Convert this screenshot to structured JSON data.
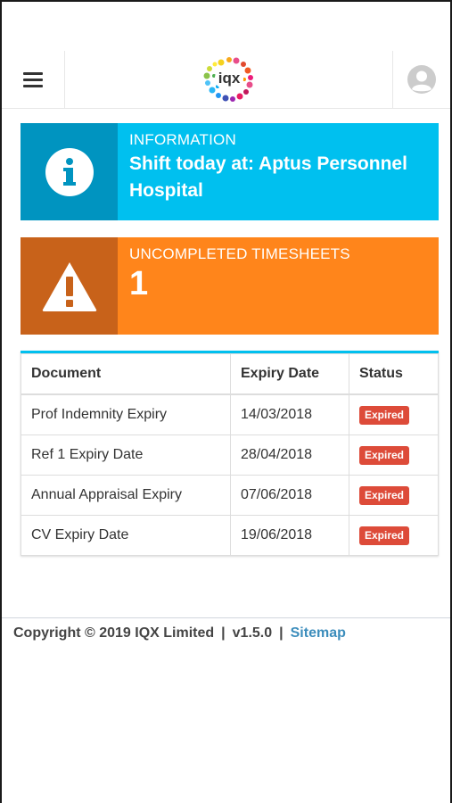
{
  "header": {
    "menu_icon": "hamburger-menu-icon",
    "logo_text": "iqx",
    "avatar_icon": "user-avatar-icon"
  },
  "info_box": {
    "label": "INFORMATION",
    "text": "Shift today at: Aptus Personnel Hospital",
    "icon": "info-icon",
    "color": "#00c0ef",
    "icon_bg": "#0094c0"
  },
  "warning_box": {
    "label": "UNCOMPLETED TIMESHEETS",
    "count": "1",
    "icon": "warning-icon",
    "color": "#ff851b",
    "icon_bg": "#c8621a"
  },
  "documents": {
    "columns": [
      "Document",
      "Expiry Date",
      "Status"
    ],
    "rows": [
      {
        "document": "Prof Indemnity Expiry",
        "expiry": "14/03/2018",
        "status": "Expired"
      },
      {
        "document": "Ref 1 Expiry Date",
        "expiry": "28/04/2018",
        "status": "Expired"
      },
      {
        "document": "Annual Appraisal Expiry",
        "expiry": "07/06/2018",
        "status": "Expired"
      },
      {
        "document": "CV Expiry Date",
        "expiry": "19/06/2018",
        "status": "Expired"
      }
    ],
    "status_color": "#dd4b39"
  },
  "footer": {
    "copyright": "Copyright © 2019 IQX Limited",
    "separator": "|",
    "version": "v1.5.0",
    "sitemap": "Sitemap"
  }
}
